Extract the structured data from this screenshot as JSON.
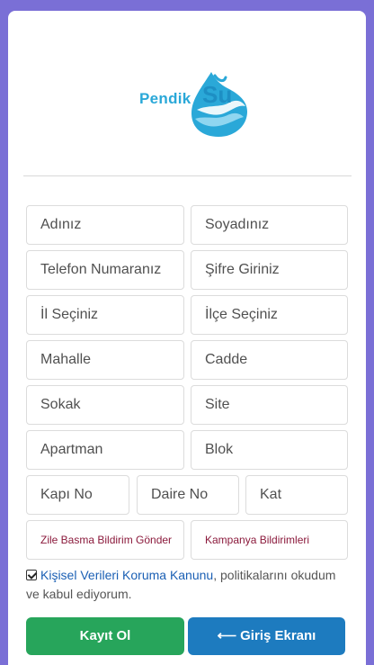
{
  "brand": {
    "name": "Pendik",
    "mark": "Su",
    "primary_color": "#2aa8d8",
    "logo_icon": "water-drop-icon"
  },
  "form": {
    "first_name_placeholder": "Adınız",
    "last_name_placeholder": "Soyadınız",
    "phone_placeholder": "Telefon Numaranız",
    "password_placeholder": "Şifre Giriniz",
    "city_placeholder": "İl Seçiniz",
    "district_placeholder": "İlçe Seçiniz",
    "neighborhood_placeholder": "Mahalle",
    "street_placeholder": "Cadde",
    "alley_placeholder": "Sokak",
    "site_placeholder": "Site",
    "apartment_placeholder": "Apartman",
    "block_placeholder": "Blok",
    "door_no_placeholder": "Kapı No",
    "flat_no_placeholder": "Daire No",
    "floor_placeholder": "Kat",
    "ring_notify_label": "Zile Basma Bildirim Gönder",
    "campaign_notify_label": "Kampanya Bildirimleri"
  },
  "consent": {
    "checked": true,
    "link_text": "Kişisel Verileri Koruma Kanunu",
    "rest_text": ", politikalarını okudum ve kabul ediyorum."
  },
  "buttons": {
    "register_label": "Kayıt Ol",
    "register_color": "#27a55b",
    "login_label": "Giriş Ekranı",
    "login_icon": "arrow-left-icon",
    "login_color": "#1d7bbf"
  }
}
